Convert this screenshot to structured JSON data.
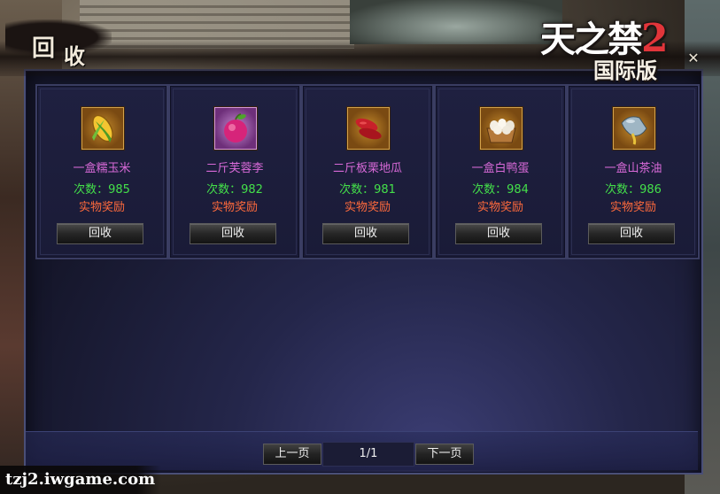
{
  "header": {
    "title_char_1": "回",
    "title_char_2": "收",
    "logo_line_1": "天之禁",
    "logo_number": "2",
    "logo_line_2": "国际版",
    "close_symbol": "✕"
  },
  "cards": [
    {
      "name": "一盒糯玉米",
      "count_label": "次数：",
      "count": "985",
      "reward": "实物奖励",
      "button": "回收",
      "icon": "corn-icon"
    },
    {
      "name": "二斤芙蓉李",
      "count_label": "次数：",
      "count": "982",
      "reward": "实物奖励",
      "button": "回收",
      "icon": "plum-icon"
    },
    {
      "name": "二斤板栗地瓜",
      "count_label": "次数：",
      "count": "981",
      "reward": "实物奖励",
      "button": "回收",
      "icon": "sweet-potato-icon"
    },
    {
      "name": "一盒白鸭蛋",
      "count_label": "次数：",
      "count": "984",
      "reward": "实物奖励",
      "button": "回收",
      "icon": "duck-egg-box-icon"
    },
    {
      "name": "一盒山茶油",
      "count_label": "次数：",
      "count": "986",
      "reward": "实物奖励",
      "button": "回收",
      "icon": "camellia-oil-icon"
    }
  ],
  "pager": {
    "prev_label": "上一页",
    "page_indicator": "1/1",
    "next_label": "下一页"
  },
  "watermark": "tzj2.iwgame.com",
  "colors": {
    "item_name": "#d86ad8",
    "count": "#44e04a",
    "reward": "#ff6a3c"
  }
}
